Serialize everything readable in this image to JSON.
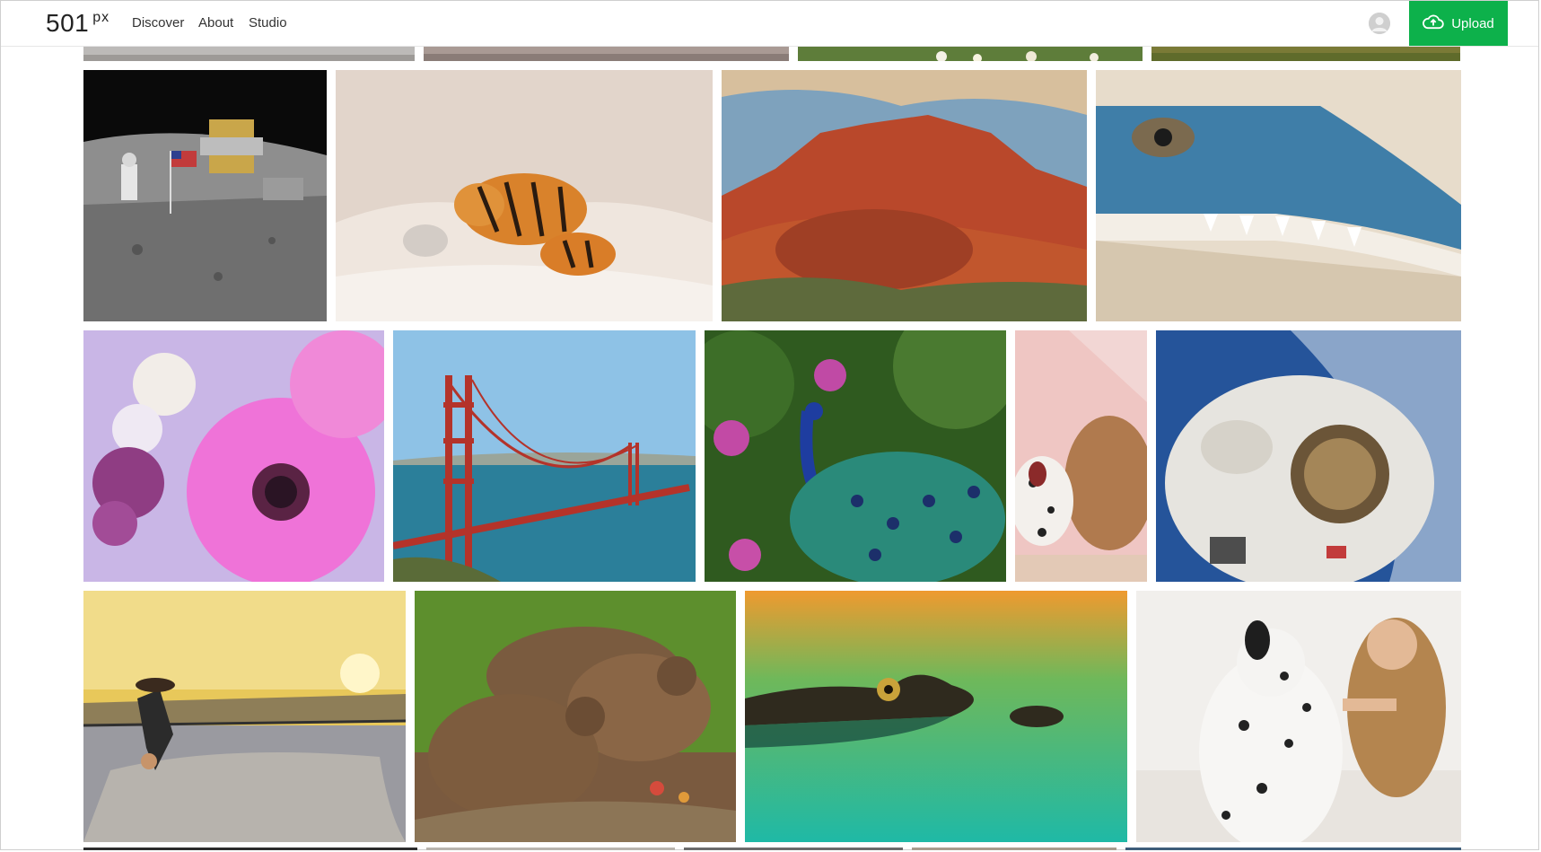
{
  "app": {
    "logo_number": "501",
    "logo_suffix": "px"
  },
  "nav": {
    "links": [
      "Discover",
      "About",
      "Studio"
    ]
  },
  "header_actions": {
    "upload_label": "Upload",
    "avatar_icon": "user-avatar-icon",
    "upload_icon": "cloud-upload-icon"
  },
  "colors": {
    "brand_green": "#0db14b"
  },
  "gallery": {
    "photos": [
      {
        "subject": "astronaut on the moon with flag"
      },
      {
        "subject": "tigers in snowy forest"
      },
      {
        "subject": "red rock canyon"
      },
      {
        "subject": "crocodile close-up"
      },
      {
        "subject": "pink gerbera flowers"
      },
      {
        "subject": "golden gate bridge"
      },
      {
        "subject": "peacock among flowers"
      },
      {
        "subject": "woman with dalmatian"
      },
      {
        "subject": "astronaut in space"
      },
      {
        "subject": "skateboarder at sunset"
      },
      {
        "subject": "capybaras"
      },
      {
        "subject": "crocodile in water"
      },
      {
        "subject": "woman hugging dalmatian"
      }
    ]
  }
}
